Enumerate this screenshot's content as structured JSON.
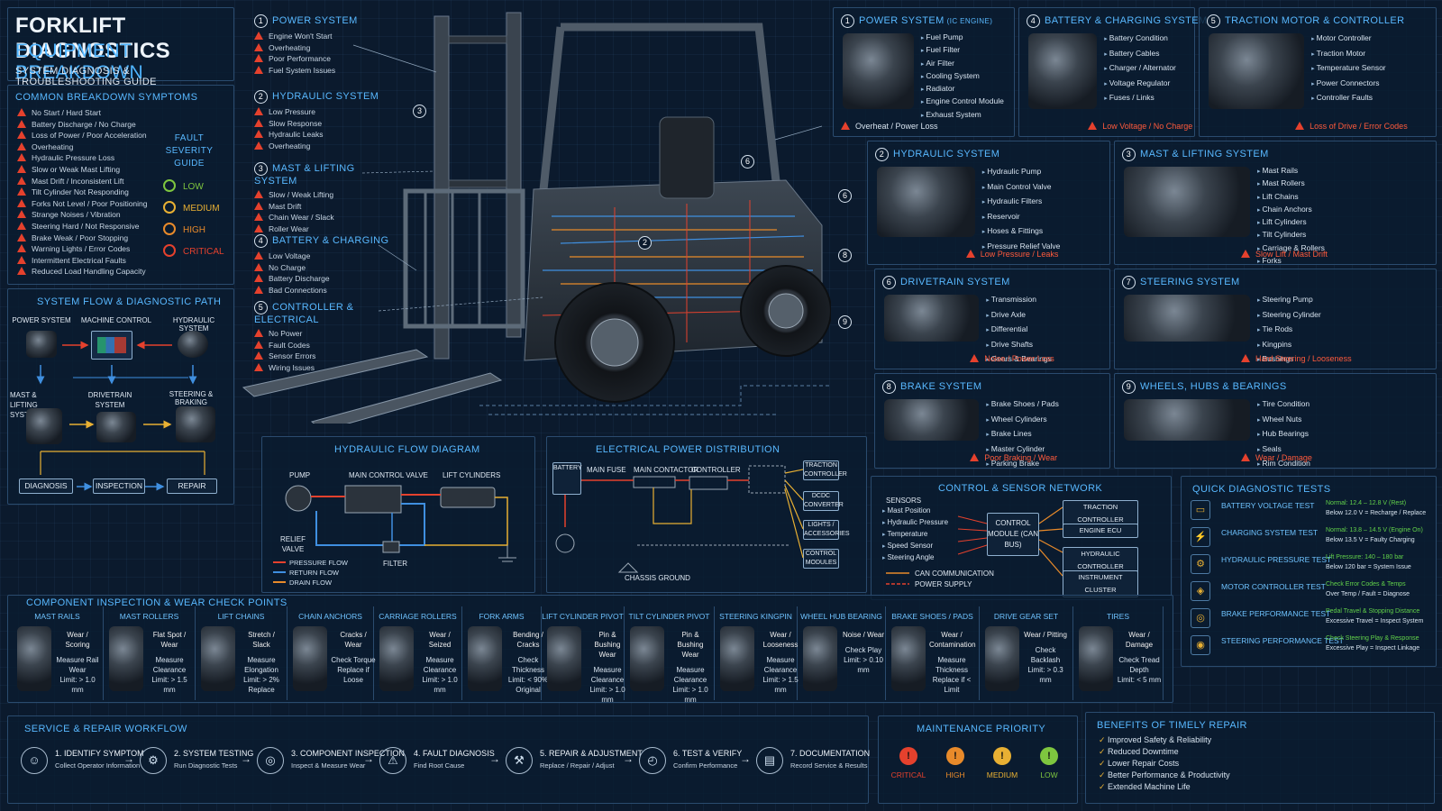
{
  "header": {
    "title": "FORKLIFT DIAGNOSTICS",
    "subtitle": "EQUIPMENT BREAKDOWN",
    "tagline": "SYSTEM DIAGNOSIS & TROUBLESHOOTING GUIDE"
  },
  "symptoms": {
    "title": "COMMON BREAKDOWN SYMPTOMS",
    "items": [
      "No Start / Hard Start",
      "Battery Discharge / No Charge",
      "Loss of Power / Poor Acceleration",
      "Overheating",
      "Hydraulic Pressure Loss",
      "Slow or Weak Mast Lifting",
      "Mast Drift / Inconsistent Lift",
      "Tilt Cylinder Not Responding",
      "Forks Not Level / Poor Positioning",
      "Strange Noises / Vibration",
      "Steering Hard / Not Responsive",
      "Brake Weak / Poor Stopping",
      "Warning Lights / Error Codes",
      "Intermittent Electrical Faults",
      "Reduced Load Handling Capacity"
    ]
  },
  "severity": {
    "title": "FAULT SEVERITY GUIDE",
    "levels": [
      {
        "label": "LOW",
        "color": "#7ec63f"
      },
      {
        "label": "MEDIUM",
        "color": "#e8b033"
      },
      {
        "label": "HIGH",
        "color": "#e88a2a"
      },
      {
        "label": "CRITICAL",
        "color": "#e5412d"
      }
    ]
  },
  "flow": {
    "title": "SYSTEM FLOW & DIAGNOSTIC PATH",
    "nodes": [
      "POWER SYSTEM",
      "MACHINE CONTROL",
      "HYDRAULIC SYSTEM",
      "MAST & LIFTING SYSTEM",
      "DRIVETRAIN SYSTEM",
      "STEERING & BRAKING"
    ],
    "steps": [
      "DIAGNOSIS",
      "INSPECTION",
      "REPAIR"
    ]
  },
  "callouts": [
    {
      "n": "1",
      "title": "POWER SYSTEM",
      "items": [
        "Engine Won't Start",
        "Overheating",
        "Poor Performance",
        "Fuel System Issues"
      ]
    },
    {
      "n": "2",
      "title": "HYDRAULIC SYSTEM",
      "items": [
        "Low Pressure",
        "Slow Response",
        "Hydraulic Leaks",
        "Overheating"
      ]
    },
    {
      "n": "3",
      "title": "MAST & LIFTING SYSTEM",
      "items": [
        "Slow / Weak Lifting",
        "Mast Drift",
        "Chain Wear / Slack",
        "Roller Wear"
      ]
    },
    {
      "n": "4",
      "title": "BATTERY & CHARGING",
      "items": [
        "Low Voltage",
        "No Charge",
        "Battery Discharge",
        "Bad Connections"
      ]
    },
    {
      "n": "5",
      "title": "CONTROLLER & ELECTRICAL",
      "items": [
        "No Power",
        "Fault Codes",
        "Sensor Errors",
        "Wiring Issues"
      ]
    }
  ],
  "marker_numbers": [
    "1",
    "2",
    "3",
    "4",
    "5",
    "6",
    "7",
    "8",
    "9"
  ],
  "systems": [
    {
      "n": "1",
      "title": "POWER SYSTEM",
      "title_suffix": "(IC ENGINE)",
      "items": [
        "Fuel Pump",
        "Fuel Filter",
        "Air Filter",
        "Cooling System",
        "Radiator",
        "Engine Control Module",
        "Exhaust System"
      ],
      "fault": "Overheat / Power Loss"
    },
    {
      "n": "4",
      "title": "BATTERY & CHARGING SYSTEM",
      "items": [
        "Battery Condition",
        "Battery Cables",
        "Charger / Alternator",
        "Voltage Regulator",
        "Fuses / Links"
      ],
      "fault": "Low Voltage / No Charge"
    },
    {
      "n": "5",
      "title": "TRACTION MOTOR & CONTROLLER",
      "items": [
        "Motor Controller",
        "Traction Motor",
        "Temperature Sensor",
        "Power Connectors",
        "Controller Faults"
      ],
      "fault": "Loss of Drive / Error Codes"
    },
    {
      "n": "2",
      "title": "HYDRAULIC SYSTEM",
      "items": [
        "Hydraulic Pump",
        "Main Control Valve",
        "Hydraulic Filters",
        "Reservoir",
        "Hoses & Fittings",
        "Pressure Relief Valve"
      ],
      "fault": "Low Pressure / Leaks"
    },
    {
      "n": "3",
      "title": "MAST & LIFTING SYSTEM",
      "items": [
        "Mast Rails",
        "Mast Rollers",
        "Lift Chains",
        "Chain Anchors",
        "Lift Cylinders",
        "Tilt Cylinders",
        "Carriage & Rollers",
        "Forks"
      ],
      "fault": "Slow Lift / Mast Drift"
    },
    {
      "n": "6",
      "title": "DRIVETRAIN SYSTEM",
      "items": [
        "Transmission",
        "Drive Axle",
        "Differential",
        "Drive Shafts",
        "Gears & Bearings"
      ],
      "fault": "Noise / Power Loss"
    },
    {
      "n": "7",
      "title": "STEERING SYSTEM",
      "items": [
        "Steering Pump",
        "Steering Cylinder",
        "Tie Rods",
        "Kingpins",
        "Bushings"
      ],
      "fault": "Hard Steering / Looseness"
    },
    {
      "n": "8",
      "title": "BRAKE SYSTEM",
      "items": [
        "Brake Shoes / Pads",
        "Wheel Cylinders",
        "Brake Lines",
        "Master Cylinder",
        "Parking Brake"
      ],
      "fault": "Poor Braking / Wear"
    },
    {
      "n": "9",
      "title": "WHEELS, HUBS & BEARINGS",
      "items": [
        "Tire Condition",
        "Wheel Nuts",
        "Hub Bearings",
        "Seals",
        "Rim Condition"
      ],
      "fault": "Wear / Damage"
    }
  ],
  "hydraulic_diagram": {
    "title": "HYDRAULIC FLOW DIAGRAM",
    "labels": [
      "PUMP",
      "MAIN CONTROL VALVE",
      "LIFT CYLINDERS",
      "RELIEF VALVE",
      "FILTER"
    ],
    "legend": [
      {
        "label": "PRESSURE FLOW",
        "color": "#e5412d"
      },
      {
        "label": "RETURN FLOW",
        "color": "#3f8fe0"
      },
      {
        "label": "DRAIN FLOW",
        "color": "#e88a2a"
      }
    ]
  },
  "electrical": {
    "title": "ELECTRICAL POWER DISTRIBUTION",
    "boxes": [
      "BATTERY",
      "MAIN FUSE",
      "MAIN CONTACTOR",
      "CONTROLLER"
    ],
    "outputs": [
      "TRACTION CONTROLLER",
      "DCDC CONVERTER",
      "LIGHTS / ACCESSORIES",
      "CONTROL MODULES"
    ],
    "ground": "CHASSIS GROUND"
  },
  "network": {
    "title": "CONTROL & SENSOR NETWORK",
    "sensors_title": "SENSORS",
    "sensors": [
      "Mast Position",
      "Hydraulic Pressure",
      "Temperature",
      "Speed Sensor",
      "Steering Angle"
    ],
    "module": "CONTROL MODULE (CAN BUS)",
    "outputs": [
      "TRACTION CONTROLLER",
      "ENGINE ECU",
      "HYDRAULIC CONTROLLER",
      "INSTRUMENT CLUSTER"
    ],
    "legend": [
      "CAN COMMUNICATION",
      "POWER SUPPLY"
    ]
  },
  "tests": {
    "title": "QUICK DIAGNOSTIC TESTS",
    "items": [
      {
        "name": "BATTERY VOLTAGE TEST",
        "v1": "Normal: 12.4 – 12.8 V (Rest)",
        "v2": "Below 12.0 V = Recharge / Replace"
      },
      {
        "name": "CHARGING SYSTEM TEST",
        "v1": "Normal: 13.8 – 14.5 V (Engine On)",
        "v2": "Below 13.5 V = Faulty Charging"
      },
      {
        "name": "HYDRAULIC PRESSURE TEST",
        "v1": "Lift Pressure: 140 – 180 bar",
        "v2": "Below 120 bar = System Issue"
      },
      {
        "name": "MOTOR CONTROLLER TEST",
        "v1": "Check Error Codes & Temps",
        "v2": "Over Temp / Fault = Diagnose"
      },
      {
        "name": "BRAKE PERFORMANCE TEST",
        "v1": "Pedal Travel & Stopping Distance",
        "v2": "Excessive Travel = Inspect System"
      },
      {
        "name": "STEERING PERFORMANCE TEST",
        "v1": "Check Steering Play & Response",
        "v2": "Excessive Play = Inspect Linkage"
      }
    ]
  },
  "inspection": {
    "title": "COMPONENT INSPECTION & WEAR CHECK POINTS",
    "parts": [
      {
        "name": "MAST RAILS",
        "issue": "Wear / Scoring",
        "check": "Measure Rail Wear",
        "limit": "Limit: > 1.0 mm"
      },
      {
        "name": "MAST ROLLERS",
        "issue": "Flat Spot / Wear",
        "check": "Measure Clearance",
        "limit": "Limit: > 1.5 mm"
      },
      {
        "name": "LIFT CHAINS",
        "issue": "Stretch / Slack",
        "check": "Measure Elongation",
        "limit": "Limit: > 2% Replace"
      },
      {
        "name": "CHAIN ANCHORS",
        "issue": "Cracks / Wear",
        "check": "Check Torque",
        "limit": "Replace if Loose"
      },
      {
        "name": "CARRIAGE ROLLERS",
        "issue": "Wear / Seized",
        "check": "Measure Clearance",
        "limit": "Limit: > 1.0 mm"
      },
      {
        "name": "FORK ARMS",
        "issue": "Bending / Cracks",
        "check": "Check Thickness",
        "limit": "Limit: < 90% Original"
      },
      {
        "name": "LIFT CYLINDER PIVOT",
        "issue": "Pin & Bushing Wear",
        "check": "Measure Clearance",
        "limit": "Limit: > 1.0 mm"
      },
      {
        "name": "TILT CYLINDER PIVOT",
        "issue": "Pin & Bushing Wear",
        "check": "Measure Clearance",
        "limit": "Limit: > 1.0 mm"
      },
      {
        "name": "STEERING KINGPIN",
        "issue": "Wear / Looseness",
        "check": "Measure Clearance",
        "limit": "Limit: > 1.5 mm"
      },
      {
        "name": "WHEEL HUB BEARING",
        "issue": "Noise / Wear",
        "check": "Check Play",
        "limit": "Limit: > 0.10 mm"
      },
      {
        "name": "BRAKE SHOES / PADS",
        "issue": "Wear / Contamination",
        "check": "Measure Thickness",
        "limit": "Replace if < Limit"
      },
      {
        "name": "DRIVE GEAR SET",
        "issue": "Wear / Pitting",
        "check": "Check Backlash",
        "limit": "Limit: > 0.3 mm"
      },
      {
        "name": "TIRES",
        "issue": "Wear / Damage",
        "check": "Check Tread Depth",
        "limit": "Limit: < 5 mm"
      }
    ]
  },
  "workflow": {
    "title": "SERVICE & REPAIR WORKFLOW",
    "steps": [
      {
        "t": "1. IDENTIFY SYMPTOM",
        "s": "Collect Operator Information"
      },
      {
        "t": "2. SYSTEM TESTING",
        "s": "Run Diagnostic Tests"
      },
      {
        "t": "3. COMPONENT INSPECTION",
        "s": "Inspect & Measure Wear"
      },
      {
        "t": "4. FAULT DIAGNOSIS",
        "s": "Find Root Cause"
      },
      {
        "t": "5. REPAIR & ADJUSTMENT",
        "s": "Replace / Repair / Adjust"
      },
      {
        "t": "6. TEST & VERIFY",
        "s": "Confirm Performance"
      },
      {
        "t": "7. DOCUMENTATION",
        "s": "Record Service & Results"
      }
    ]
  },
  "priority": {
    "title": "MAINTENANCE PRIORITY",
    "levels": [
      {
        "label": "CRITICAL",
        "color": "#e5412d"
      },
      {
        "label": "HIGH",
        "color": "#e88a2a"
      },
      {
        "label": "MEDIUM",
        "color": "#e8b033"
      },
      {
        "label": "LOW",
        "color": "#7ec63f"
      }
    ]
  },
  "benefits": {
    "title": "BENEFITS OF TIMELY REPAIR",
    "items": [
      "Improved Safety & Reliability",
      "Reduced Downtime",
      "Lower Repair Costs",
      "Better Performance & Productivity",
      "Extended Machine Life"
    ]
  }
}
